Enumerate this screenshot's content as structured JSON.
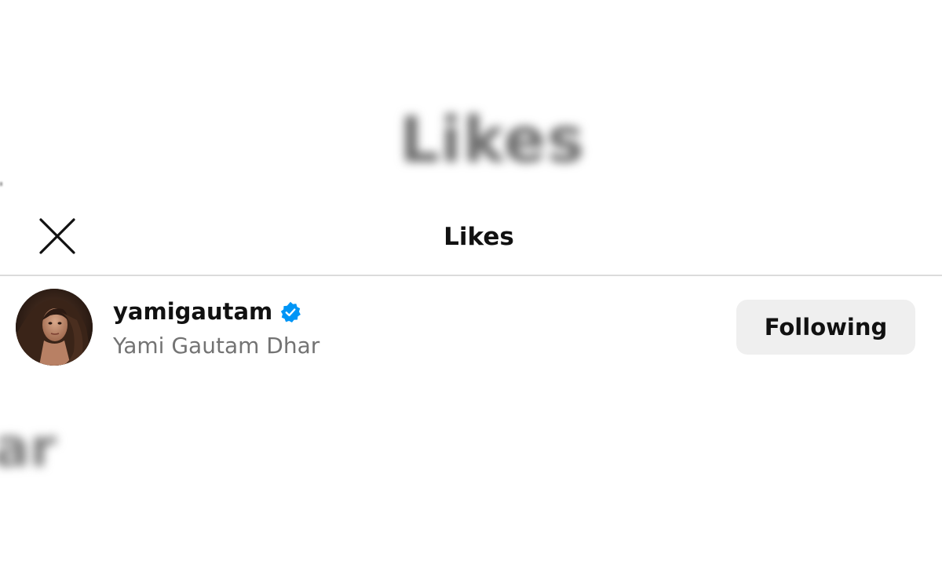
{
  "background": {
    "blurred_title": "Likes",
    "blurred_fragment": "ar"
  },
  "header": {
    "title": "Likes",
    "close_icon": "close-icon"
  },
  "likes": [
    {
      "username": "yamigautam",
      "verified": true,
      "full_name": "Yami Gautam Dhar",
      "follow_button_label": "Following"
    }
  ],
  "colors": {
    "verified_badge": "#0095f6",
    "button_bg": "#efefef",
    "secondary_text": "#737373",
    "divider": "#dbdbdb"
  }
}
